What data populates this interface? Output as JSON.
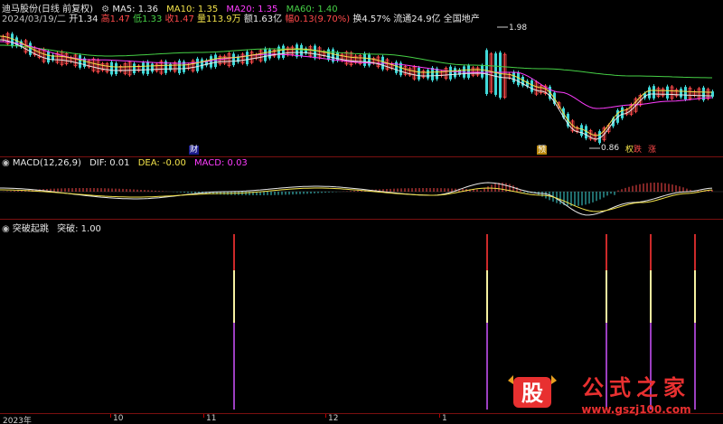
{
  "colors": {
    "ma5": "#e8e8e8",
    "ma10": "#f2e24a",
    "ma20": "#ff3cff",
    "ma60": "#46d046",
    "up": "#ff4a4a",
    "down": "#40d8d8"
  },
  "header": {
    "stock_name": "迪马股份(日线 前复权)",
    "ma5": "MA5: 1.36",
    "ma10": "MA10: 1.35",
    "ma20": "MA20: 1.35",
    "ma60": "MA60: 1.40",
    "date": "2024/03/19/二",
    "open": "开1.34",
    "high": "高1.47",
    "low": "低1.33",
    "close": "收1.47",
    "volume": "量113.9万",
    "amount": "额1.63亿",
    "change": "幅0.13(9.70%)",
    "turnover": "换4.57%",
    "float": "流通24.9亿",
    "sector": "全国地产"
  },
  "price_pane": {
    "high_marker": "1.98",
    "low_marker": "0.86",
    "tag_cai": "财",
    "tag_yu": "预",
    "tag_quan": "权",
    "tag_die": "跌",
    "tag_zhang": "涨"
  },
  "macd": {
    "title": "MACD(12,26,9)",
    "dif": "DIF: 0.01",
    "dea": "DEA: -0.00",
    "macd": "MACD: 0.03"
  },
  "signal": {
    "title": "突破起跳",
    "label": "突破: 1.00"
  },
  "x_axis": {
    "labels": [
      "2023年",
      "10",
      "11",
      "12",
      "1"
    ]
  },
  "watermark": {
    "logo": "股",
    "text": "公式之家",
    "url": "www.gszj100.com"
  }
}
